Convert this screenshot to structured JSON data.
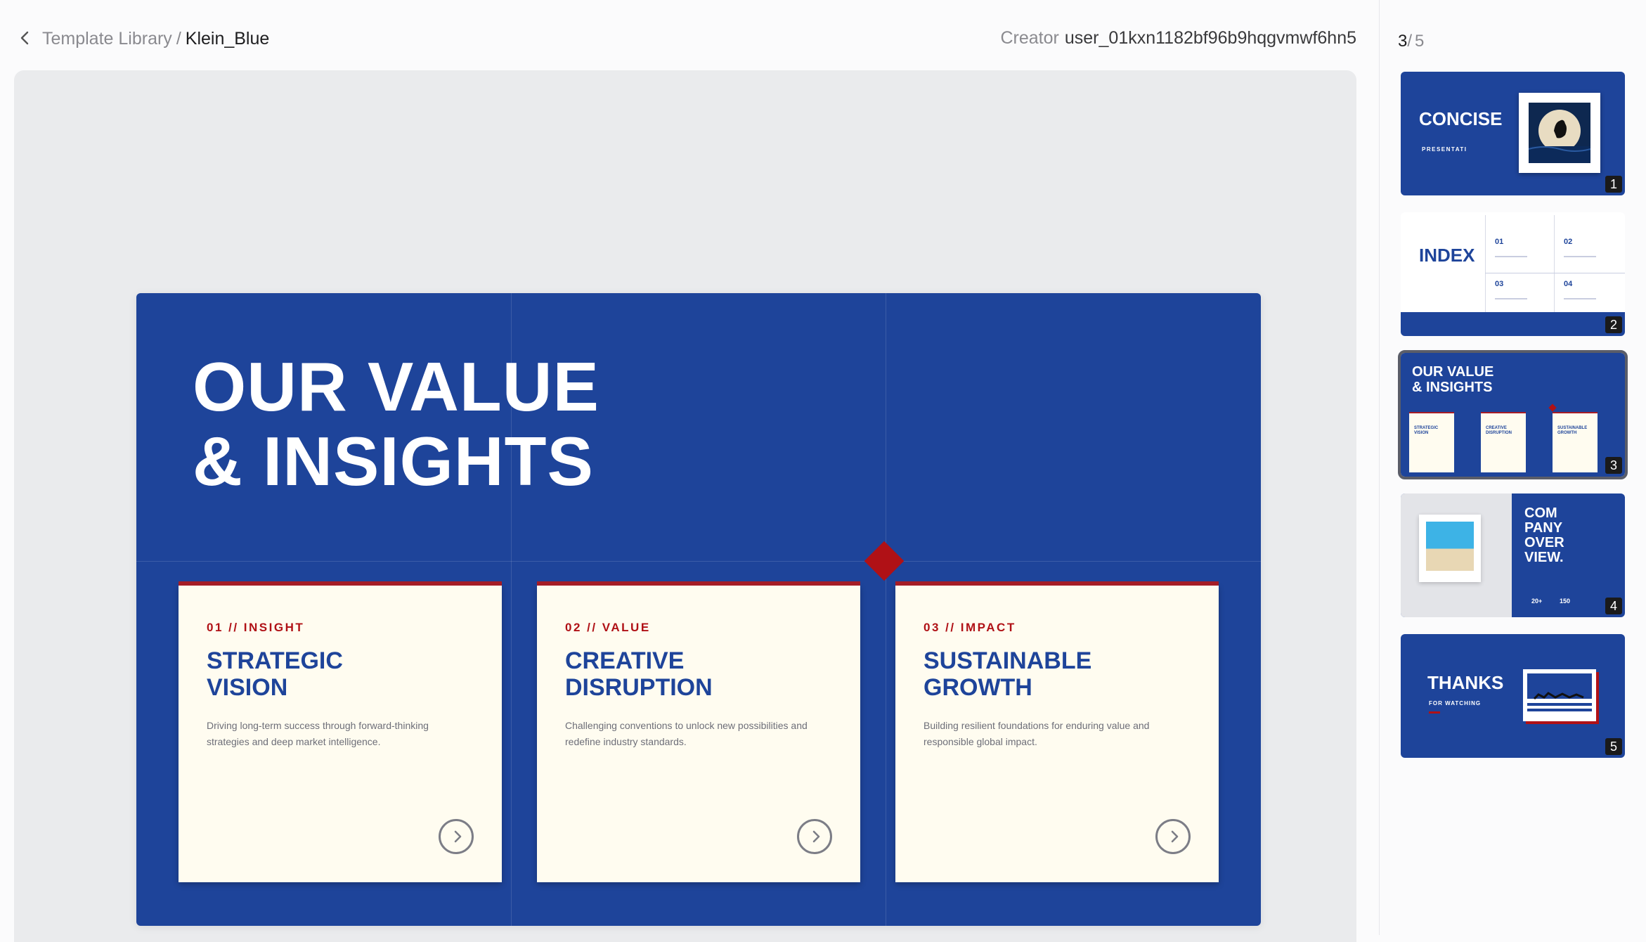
{
  "header": {
    "breadcrumb_parent": "Template Library",
    "breadcrumb_separator": "/",
    "breadcrumb_current": "Klein_Blue",
    "creator_label": "Creator",
    "creator_value": "user_01kxn1182bf96b9hqgvmwf6hn5"
  },
  "slide": {
    "title_line1": "OUR VALUE",
    "title_line2": "& INSIGHTS",
    "cards": [
      {
        "tag": "01 // INSIGHT",
        "title_line1": "STRATEGIC",
        "title_line2": "VISION",
        "description": "Driving long-term success through forward-thinking strategies and deep market intelligence."
      },
      {
        "tag": "02 // VALUE",
        "title_line1": "CREATIVE",
        "title_line2": "DISRUPTION",
        "description": "Challenging conventions to unlock new possibilities and redefine industry standards."
      },
      {
        "tag": "03 // IMPACT",
        "title_line1": "SUSTAINABLE",
        "title_line2": "GROWTH",
        "description": "Building resilient foundations for enduring value and responsible global impact."
      }
    ]
  },
  "sidebar": {
    "current_page": "3",
    "separator": "/",
    "total_pages": "5",
    "thumbs": [
      {
        "number": "1",
        "title": "CONCISE",
        "subtitle": "PRESENTATI"
      },
      {
        "number": "2",
        "title": "INDEX",
        "items": [
          "01",
          "02",
          "03",
          "04"
        ]
      },
      {
        "number": "3",
        "title_line1": "OUR VALUE",
        "title_line2": "& INSIGHTS",
        "cards": [
          {
            "line1": "STRATEGIC",
            "line2": "VISION"
          },
          {
            "line1": "CREATIVE",
            "line2": "DISRUPTION"
          },
          {
            "line1": "SUSTAINABLE",
            "line2": "GROWTH"
          }
        ]
      },
      {
        "number": "4",
        "title_lines": [
          "COM",
          "PANY",
          "OVER",
          "VIEW."
        ],
        "stats": [
          "20+",
          "150"
        ]
      },
      {
        "number": "5",
        "title": "THANKS",
        "subtitle": "FOR WATCHING"
      }
    ]
  },
  "colors": {
    "klein_blue": "#1e449a",
    "accent_red": "#b01116",
    "card_background": "#fffcf0"
  },
  "icons": {
    "back": "chevron-left-icon",
    "card_arrow": "circle-chevron-right-icon"
  }
}
